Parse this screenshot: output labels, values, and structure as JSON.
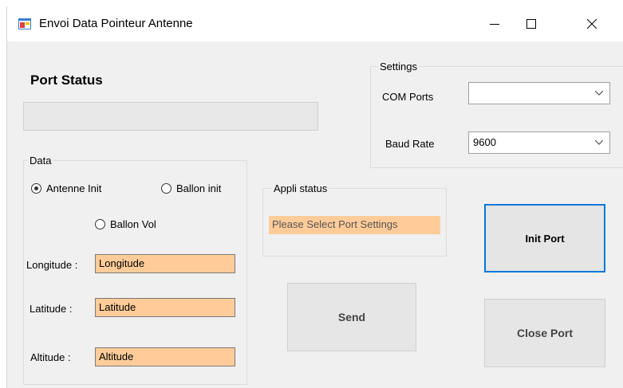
{
  "window": {
    "title": "Envoi Data  Pointeur Antenne",
    "minimize_icon": "minimize-icon",
    "maximize_icon": "maximize-icon",
    "close_icon": "close-icon"
  },
  "port_status": {
    "heading": "Port Status",
    "value": ""
  },
  "settings": {
    "group_label": "Settings",
    "com_ports_label": "COM Ports",
    "com_ports_value": "",
    "baud_rate_label": "Baud Rate",
    "baud_rate_value": "9600"
  },
  "data": {
    "group_label": "Data",
    "radio_antenne_init": "Antenne Init",
    "radio_ballon_init": "Ballon init",
    "radio_ballon_vol": "Ballon Vol",
    "selected": "Antenne Init",
    "longitude_label": "Longitude :",
    "longitude_value": "Longitude",
    "latitude_label": "Latitude :",
    "latitude_value": "Latitude",
    "altitude_label": "Altitude :",
    "altitude_value": "Altitude"
  },
  "appli_status": {
    "group_label": "Appli status",
    "value": "Please Select Port Settings"
  },
  "buttons": {
    "init_port": "Init Port",
    "send": "Send",
    "close_port": "Close Port"
  },
  "colors": {
    "field_bg": "#ffcc99",
    "focus_border": "#0078d7",
    "window_bg": "#f0f0f0"
  }
}
